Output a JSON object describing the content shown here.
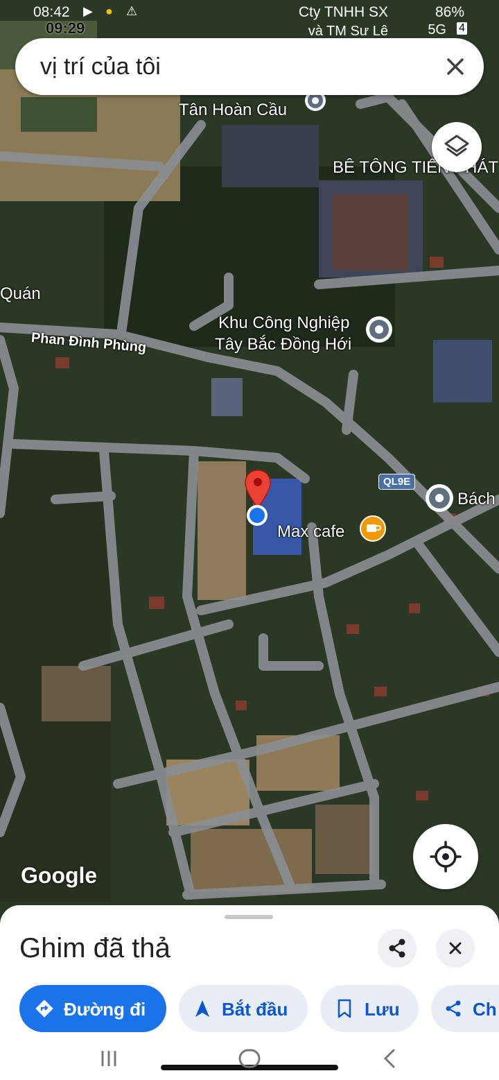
{
  "status_bar": {
    "time_top": "08:42",
    "time_overlay": "09:29",
    "carrier_line1": "Cty TNHH SX",
    "carrier_line2": "và TM Sư Lê",
    "battery": "86%",
    "network": "5G",
    "sim_slot": "4"
  },
  "search": {
    "query": "vị trí của tôi",
    "clear_icon": "close-icon"
  },
  "map": {
    "attribution": "Google",
    "labels": {
      "tan_hoan_cau": "Tân Hoàn Cầu",
      "be_tong": "BÊ TÔNG TIẾN PHÁT",
      "quan": "Quán",
      "kcn_line1": "Khu Công Nghiệp",
      "kcn_line2": "Tây Bắc Đồng Hới",
      "street": "Phan Đình Phùng",
      "road_shield": "QL9E",
      "bach": "Bách",
      "cafe": "Max cafe"
    },
    "icons": [
      "layers-icon",
      "my-location-icon",
      "dropped-pin-icon",
      "cafe-icon"
    ]
  },
  "sheet": {
    "title": "Ghim đã thả",
    "share_icon": "share-icon",
    "close_icon": "close-icon",
    "chips": {
      "directions": "Đường đi",
      "start": "Bắt đầu",
      "save": "Lưu",
      "share": "Ch"
    }
  },
  "colors": {
    "primary": "#1a73e8",
    "pin": "#ea4335",
    "cafe": "#f29900"
  }
}
